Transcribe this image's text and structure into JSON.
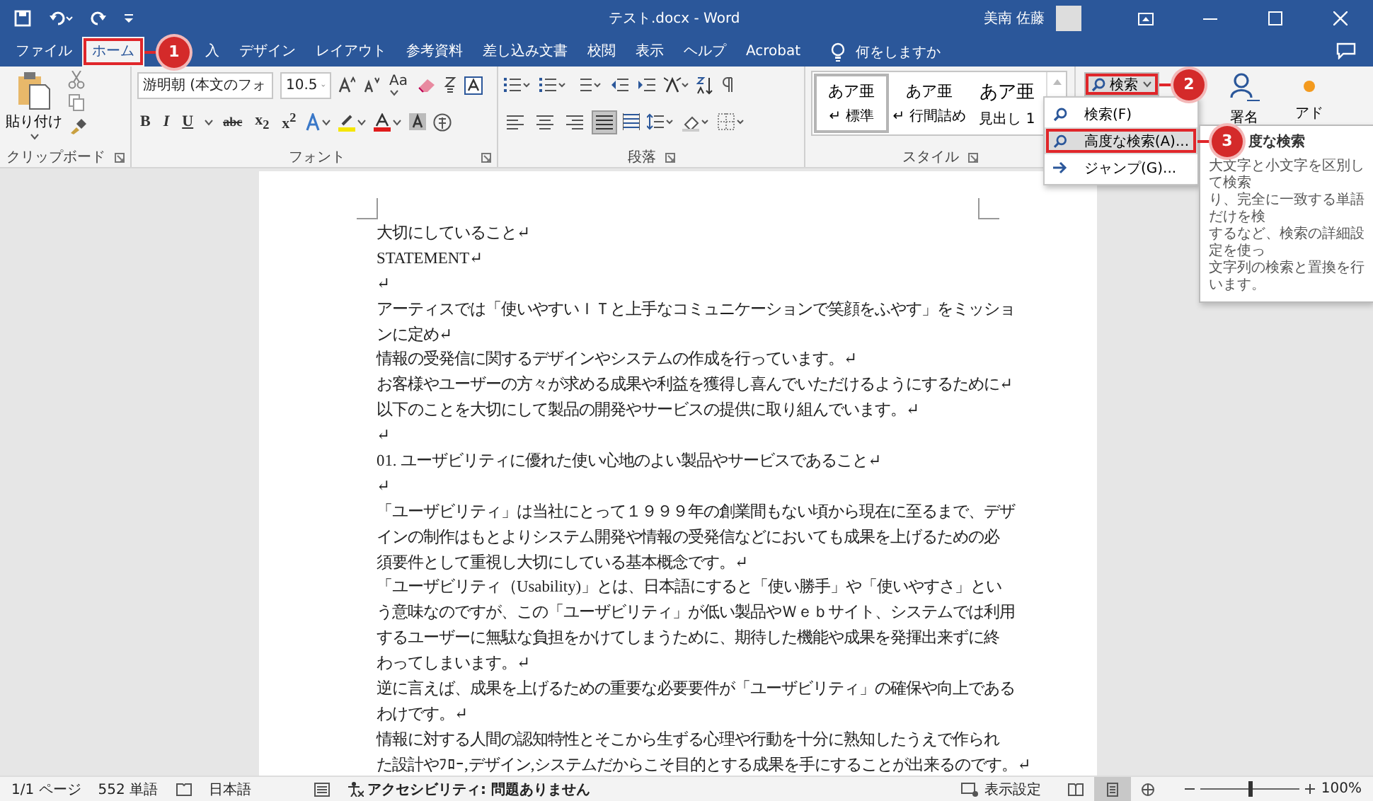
{
  "window": {
    "title": "テスト.docx  -  Word",
    "user": "美南 佐藤"
  },
  "tabs": [
    {
      "label": "ファイル",
      "selected": false,
      "highlighted": false
    },
    {
      "label": "ホーム",
      "selected": true,
      "highlighted": true
    },
    {
      "label": "入",
      "selected": false,
      "highlighted": false
    },
    {
      "label": "デザイン",
      "selected": false,
      "highlighted": false
    },
    {
      "label": "レイアウト",
      "selected": false,
      "highlighted": false
    },
    {
      "label": "参考資料",
      "selected": false,
      "highlighted": false
    },
    {
      "label": "差し込み文書",
      "selected": false,
      "highlighted": false
    },
    {
      "label": "校閲",
      "selected": false,
      "highlighted": false
    },
    {
      "label": "表示",
      "selected": false,
      "highlighted": false
    },
    {
      "label": "ヘルプ",
      "selected": false,
      "highlighted": false
    },
    {
      "label": "Acrobat",
      "selected": false,
      "highlighted": false
    }
  ],
  "tell_me": {
    "placeholder": "何をしますか"
  },
  "ribbon": {
    "clipboard": {
      "paste_label": "貼り付け",
      "group_label": "クリップボード"
    },
    "font": {
      "font_name": "游明朝 (本文のフォ",
      "font_size": "10.5",
      "case_button": "Aa",
      "format_buttons": [
        "B",
        "I",
        "U",
        "abc",
        "x$_{2}$",
        "x$^{2}$"
      ],
      "group_label": "フォント"
    },
    "paragraph": {
      "alignment_buttons": [
        {
          "selected": false
        },
        {
          "selected": false
        },
        {
          "selected": false
        },
        {
          "selected": true
        }
      ],
      "group_label": "段落"
    },
    "styles": {
      "items": [
        {
          "preview": "あア亜",
          "name": "↵ 標準",
          "selected": true
        },
        {
          "preview": "あア亜",
          "name": "↵ 行間詰め",
          "selected": false
        },
        {
          "preview": "あア亜",
          "name": "見出し 1",
          "selected": false
        }
      ],
      "group_label": "スタイル"
    },
    "editing": {
      "search_button": {
        "label": "検索",
        "highlighted": true
      },
      "sign_label": "署名",
      "addin_label": "アド"
    }
  },
  "search_menu": {
    "items": [
      {
        "label": "検索(F)",
        "kind": "search",
        "highlighted": false
      },
      {
        "label": "高度な検索(A)...",
        "kind": "search",
        "highlighted": true
      },
      {
        "label": "ジャンプ(G)...",
        "kind": "jump",
        "highlighted": false
      }
    ]
  },
  "tooltip": {
    "title": "度な検索",
    "lines": [
      "大文字と小文字を区別して検索",
      "り、完全に一致する単語だけを検",
      "するなど、検索の詳細設定を使っ",
      "文字列の検索と置換を行います。"
    ]
  },
  "callouts": [
    {
      "number": "1"
    },
    {
      "number": "2"
    },
    {
      "number": "3"
    }
  ],
  "document": {
    "lines": [
      "大切にしていること↵",
      "STATEMENT↵",
      "↵",
      "アーティスでは「使いやすいＩＴと上手なコミュニケーションで笑顔をふやす」をミッショ",
      "ンに定め↵",
      "情報の受発信に関するデザインやシステムの作成を行っています。↵",
      "お客様やユーザーの方々が求める成果や利益を獲得し喜んでいただけるようにするために↵",
      "以下のことを大切にして製品の開発やサービスの提供に取り組んでいます。↵",
      "↵",
      "01. ユーザビリティに優れた使い心地のよい製品やサービスであること↵",
      "↵",
      "「ユーザビリティ」は当社にとって１９９９年の創業間もない頃から現在に至るまで、デザ",
      "インの制作はもとよりシステム開発や情報の受発信などにおいても成果を上げるための必",
      "須要件として重視し大切にしている基本概念です。↵",
      "「ユーザビリティ（Usability)」とは、日本語にすると「使い勝手」や「使いやすさ」とい",
      "う意味なのですが、この「ユーザビリティ」が低い製品やＷｅｂサイト、システムでは利用",
      "するユーザーに無駄な負担をかけてしまうために、期待した機能や成果を発揮出来ずに終",
      "わってしまいます。↵",
      "逆に言えば、成果を上げるための重要な必要要件が「ユーザビリティ」の確保や向上である",
      "わけです。↵",
      "情報に対する人間の認知特性とそこから生ずる心理や行動を十分に熟知したうえで作られ",
      "た設計やﾌﾛｰ,デザイン,システムだからこそ目的とする成果を手にすることが出来るのです。↵"
    ]
  },
  "status_bar": {
    "page": "1/1 ページ",
    "words": "552 単語",
    "language": "日本語",
    "accessibility": "アクセシビリティ: 問題ありません",
    "display_settings": "表示設定",
    "views": [
      {
        "selected": false
      },
      {
        "selected": true
      },
      {
        "selected": false
      }
    ],
    "zoom": {
      "level": 0.5,
      "reading": "100%"
    }
  }
}
